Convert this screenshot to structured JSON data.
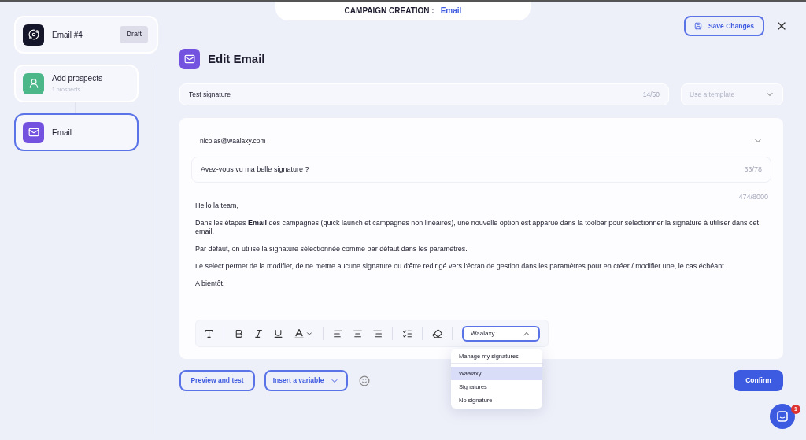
{
  "header": {
    "label": "CAMPAIGN CREATION :",
    "value": "Email"
  },
  "campaign": {
    "name": "Email #4",
    "badge": "Draft",
    "color": "#16162a"
  },
  "steps": [
    {
      "kind": "prospects",
      "title": "Add prospects",
      "subtitle": "1 prospects",
      "color": "#4cb88a",
      "selected": false
    },
    {
      "kind": "email",
      "title": "Email",
      "color": "#7452e0",
      "selected": true
    }
  ],
  "save_button": "Save Changes",
  "editor": {
    "title": "Edit Email",
    "name_field": {
      "value": "Test signature",
      "counter": "14/50"
    },
    "template_select": {
      "placeholder": "Use a template"
    },
    "sender": "nicolas@waalaxy.com",
    "subject": {
      "value": "Avez-vous vu ma belle signature ?",
      "counter": "33/78"
    },
    "body_counter": "474/8000",
    "body": [
      "Hello la team,",
      "Dans les étapes **Email** des campagnes (quick launch et campagnes non linéaires), une nouvelle option est apparue dans la toolbar pour sélectionner la signature à utiliser dans cet email.",
      "Par défaut, on utilise la signature sélectionnée comme par défaut dans les paramètres.",
      "Le select permet de la modifier, de ne mettre aucune signature ou d'être redirigé vers l'écran de gestion dans les paramètres pour en créer / modifier une, le cas échéant.",
      "A bientôt,"
    ],
    "signature_select": {
      "value": "Waalaxy",
      "expanded": true,
      "manage": "Manage my signatures",
      "options": [
        {
          "label": "Waalaxy",
          "selected": true
        },
        {
          "label": "Signatures",
          "selected": false
        },
        {
          "label": "No signature",
          "selected": false
        }
      ]
    }
  },
  "footer": {
    "preview": "Preview and test",
    "variable": "Insert a variable",
    "confirm": "Confirm"
  },
  "chat": {
    "badge": "1"
  }
}
